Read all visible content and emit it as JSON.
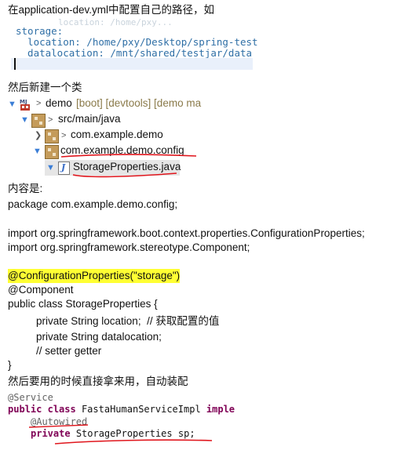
{
  "intro": "在application-dev.yml中配置自己的路径，如",
  "yaml": {
    "faded_top": "location: /home/pxy...",
    "lines": [
      "storage:",
      "  location: /home/pxy/Desktop/spring-test",
      "  datalocation: /mnt/shared/testjar/data"
    ]
  },
  "step2": "然后新建一个类",
  "tree": {
    "project": "demo",
    "project_meta": "[boot] [devtools] [demo ma",
    "src": "src/main/java",
    "pkg1": "com.example.demo",
    "pkg2": "com.example.demo.config",
    "file": "StorageProperties.java"
  },
  "content_label": "内容是:",
  "java": {
    "package": "package com.example.demo.config;",
    "import1": "import org.springframework.boot.context.properties.ConfigurationProperties;",
    "import2": "import org.springframework.stereotype.Component;",
    "annotation1": "@ConfigurationProperties(\"storage\")",
    "annotation2": "@Component",
    "class_decl": "public class StorageProperties {",
    "field1": "private String location;  // 获取配置的值",
    "field2": "private String datalocation;",
    "comment": "// setter getter",
    "close": "}"
  },
  "step3": "然后要用的时候直接拿来用，自动装配",
  "code": {
    "service": "@Service",
    "kw_public": "public",
    "kw_class": "class",
    "class_name": "FastaHumanServiceImpl",
    "kw_impl": "imple",
    "autowired": "@Autowired",
    "kw_private": "private",
    "field_type": "StorageProperties",
    "field_name": "sp;"
  },
  "colors": {
    "highlight": "#ffff33",
    "underline": "#e0161d",
    "yaml": "#2f6fa6",
    "keyword": "#7f0055"
  }
}
